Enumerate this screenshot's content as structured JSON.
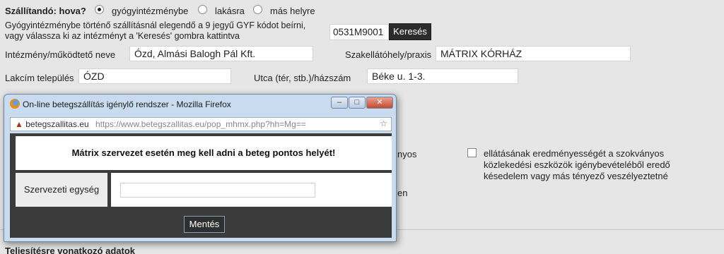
{
  "delivery": {
    "question": "Szállítandó: hova?",
    "options": [
      "gyógyintézménybe",
      "lakásra",
      "más helyre"
    ],
    "selected": "gyógyintézménybe"
  },
  "info_text": {
    "line1": "Gyógyintézménybe történő szállításnál elegendő a 9 jegyű GYF kódot beírni,",
    "line2": "vagy válassza ki az intézményt a 'Keresés' gombra kattintva"
  },
  "gyf_code": "0531M9001",
  "search_button": "Keresés",
  "institution": {
    "label": "Intézmény/működtető neve",
    "value": "Ózd, Almási Balogh Pál Kft."
  },
  "department": {
    "label": "Szakellátóhely/praxis",
    "value": "MÁTRIX KÓRHÁZ"
  },
  "city": {
    "label": "Lakcím település",
    "value": "ÓZD"
  },
  "street": {
    "label": "Utca (tér, stb.)/házszám",
    "value": "Béke u. 1-3."
  },
  "background_fragments": {
    "left_word": "nyos",
    "left_word2": "en",
    "checkbox_text": [
      "ellátásának eredményességét a szokványos",
      "közlekedési eszközök igénybevételéből eredő",
      "késedelem vagy más tényező veszélyeztetné"
    ],
    "section_title": "Teljesítésre vonatkozó adatok"
  },
  "popup": {
    "title": "On-line betegszállítás igénylő rendszer - Mozilla Firefox",
    "host": "betegszallitas.eu",
    "url": "https://www.betegszallitas.eu/pop_mhmx.php?hh=Mg==",
    "message": "Mátrix szervezet esetén meg kell adni a beteg pontos helyét!",
    "unit_label": "Szervezeti egység",
    "unit_value": "",
    "save_button": "Mentés"
  }
}
